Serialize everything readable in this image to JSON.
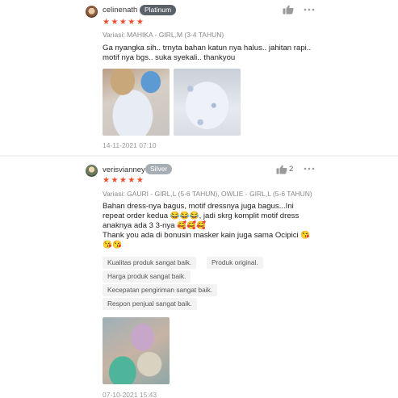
{
  "reviews": [
    {
      "username": "celinenath",
      "badge": "Platinum",
      "rating_stars": "★★★★★",
      "rating": 5,
      "variation": "Variasi: MAHIKA - GIRL,M (3-4 TAHUN)",
      "comment": "Ga nyangka sih.. trnyta bahan katun nya halus.. jahitan rapi.. motif nya bgs.. suka syekali.. thankyou",
      "timestamp": "14-11-2021 07:10",
      "like_count": ""
    },
    {
      "username": "verisvianney",
      "badge": "Silver",
      "rating_stars": "★★★★★",
      "rating": 5,
      "variation": "Variasi: GAURI - GIRL,L (5-6 TAHUN), OWLIE - GIRL,L (5-6 TAHUN)",
      "comment": "Bahan dress-nya bagus, motif dressnya juga bagus...Ini repeat order kedua 😂😂😂, jadi skrg komplit motif dress anaknya ada 3 3-nya 🥰🥰🥰\nThank you ada di bonusin masker kain juga sama Ocipici 😘😘😘",
      "tags": [
        "Kualitas produk sangat baik.",
        "Produk original.",
        "Harga produk sangat baik.",
        "Kecepatan pengiriman sangat baik.",
        "Respon penjual sangat baik."
      ],
      "timestamp": "07-10-2021 15:43",
      "like_count": "2"
    }
  ],
  "icons": {
    "like": "thumbs-up-icon",
    "more": "more-horizontal-icon"
  },
  "colors": {
    "star": "#ee4d2d",
    "badge_platinum": "#5a6169",
    "badge_silver": "#a7adb5"
  }
}
